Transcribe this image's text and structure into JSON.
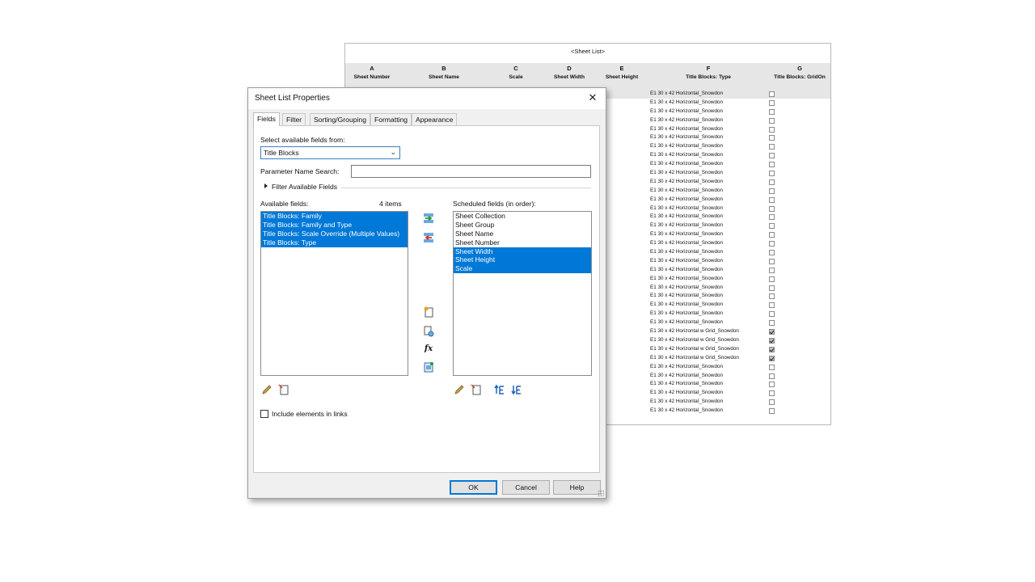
{
  "schedule": {
    "title": "<Sheet List>",
    "columns": [
      {
        "letter": "A",
        "name": "Sheet Number"
      },
      {
        "letter": "B",
        "name": "Sheet Name"
      },
      {
        "letter": "C",
        "name": "Scale"
      },
      {
        "letter": "D",
        "name": "Sheet Width"
      },
      {
        "letter": "E",
        "name": "Sheet Height"
      },
      {
        "letter": "F",
        "name": "Title Blocks: Type"
      },
      {
        "letter": "G",
        "name": "Title Blocks: GridOn"
      }
    ],
    "rows": [
      {
        "type": "E1 30 x 42 Horizontal_Snowdon",
        "grid_on": false
      },
      {
        "type": "E1 30 x 42 Horizontal_Snowdon",
        "grid_on": false
      },
      {
        "type": "E1 30 x 42 Horizontal_Snowdon",
        "grid_on": false
      },
      {
        "type": "E1 30 x 42 Horizontal_Snowdon",
        "grid_on": false
      },
      {
        "type": "E1 30 x 42 Horizontal_Snowdon",
        "grid_on": false
      },
      {
        "type": "E1 30 x 42 Horizontal_Snowdon",
        "grid_on": false
      },
      {
        "type": "E1 30 x 42 Horizontal_Snowdon",
        "grid_on": false
      },
      {
        "type": "E1 30 x 42 Horizontal_Snowdon",
        "grid_on": false
      },
      {
        "type": "E1 30 x 42 Horizontal_Snowdon",
        "grid_on": false
      },
      {
        "type": "E1 30 x 42 Horizontal_Snowdon",
        "grid_on": false
      },
      {
        "type": "E1 30 x 42 Horizontal_Snowdon",
        "grid_on": false
      },
      {
        "type": "E1 30 x 42 Horizontal_Snowdon",
        "grid_on": false
      },
      {
        "type": "E1 30 x 42 Horizontal_Snowdon",
        "grid_on": false
      },
      {
        "type": "E1 30 x 42 Horizontal_Snowdon",
        "grid_on": false
      },
      {
        "type": "E1 30 x 42 Horizontal_Snowdon",
        "grid_on": false
      },
      {
        "type": "E1 30 x 42 Horizontal_Snowdon",
        "grid_on": false
      },
      {
        "type": "E1 30 x 42 Horizontal_Snowdon",
        "grid_on": false
      },
      {
        "type": "E1 30 x 42 Horizontal_Snowdon",
        "grid_on": false
      },
      {
        "type": "E1 30 x 42 Horizontal_Snowdon",
        "grid_on": false
      },
      {
        "type": "E1 30 x 42 Horizontal_Snowdon",
        "grid_on": false
      },
      {
        "type": "E1 30 x 42 Horizontal_Snowdon",
        "grid_on": false
      },
      {
        "type": "E1 30 x 42 Horizontal_Snowdon",
        "grid_on": false
      },
      {
        "type": "E1 30 x 42 Horizontal_Snowdon",
        "grid_on": false
      },
      {
        "type": "E1 30 x 42 Horizontal_Snowdon",
        "grid_on": false
      },
      {
        "type": "E1 30 x 42 Horizontal_Snowdon",
        "grid_on": false
      },
      {
        "type": "E1 30 x 42 Horizontal_Snowdon",
        "grid_on": false
      },
      {
        "type": "E1 30 x 42 Horizontal_Snowdon",
        "grid_on": false
      },
      {
        "type": "E1 30 x 42 Horizontal w Grid_Snowdon",
        "grid_on": true
      },
      {
        "type": "E1 30 x 42 Horizontal w Grid_Snowdon",
        "grid_on": true
      },
      {
        "type": "E1 30 x 42 Horizontal w Grid_Snowdon",
        "grid_on": true
      },
      {
        "type": "E1 30 x 42 Horizontal w Grid_Snowdon",
        "grid_on": true
      },
      {
        "type": "E1 30 x 42 Horizontal_Snowdon",
        "grid_on": false
      },
      {
        "type": "E1 30 x 42 Horizontal_Snowdon",
        "grid_on": false
      },
      {
        "type": "E1 30 x 42 Horizontal_Snowdon",
        "grid_on": false
      },
      {
        "type": "E1 30 x 42 Horizontal_Snowdon",
        "grid_on": false
      },
      {
        "type": "E1 30 x 42 Horizontal_Snowdon",
        "grid_on": false
      },
      {
        "type": "E1 30 x 42 Horizontal_Snowdon",
        "grid_on": false
      }
    ]
  },
  "dialog": {
    "title": "Sheet List Properties",
    "close_glyph": "✕",
    "tabs": [
      "Fields",
      "Filter",
      "Sorting/Grouping",
      "Formatting",
      "Appearance"
    ],
    "active_tab": "Fields",
    "select_from_label": "Select available fields from:",
    "select_from_value": "Title Blocks",
    "param_search_label": "Parameter Name Search:",
    "param_search_value": "",
    "filter_available_label": "Filter Available Fields",
    "available_label": "Available fields:",
    "available_count": "4 items",
    "available_fields": [
      {
        "label": "Title Blocks: Family",
        "selected": true
      },
      {
        "label": "Title Blocks: Family and Type",
        "selected": true
      },
      {
        "label": "Title Blocks: Scale Override (Multiple Values)",
        "selected": true
      },
      {
        "label": "Title Blocks: Type",
        "selected": true
      }
    ],
    "scheduled_label": "Scheduled fields (in order):",
    "scheduled_fields": [
      {
        "label": "Sheet Collection",
        "selected": false
      },
      {
        "label": "Sheet Group",
        "selected": false
      },
      {
        "label": "Sheet Name",
        "selected": false
      },
      {
        "label": "Sheet Number",
        "selected": false
      },
      {
        "label": "Sheet Width",
        "selected": true
      },
      {
        "label": "Sheet Height",
        "selected": true
      },
      {
        "label": "Scale",
        "selected": true
      }
    ],
    "include_links_label": "Include elements in links",
    "include_links_checked": false,
    "buttons": {
      "ok": "OK",
      "cancel": "Cancel",
      "help": "Help"
    },
    "colors": {
      "selection": "#0078d7",
      "ok_border": "#0078d7"
    }
  }
}
